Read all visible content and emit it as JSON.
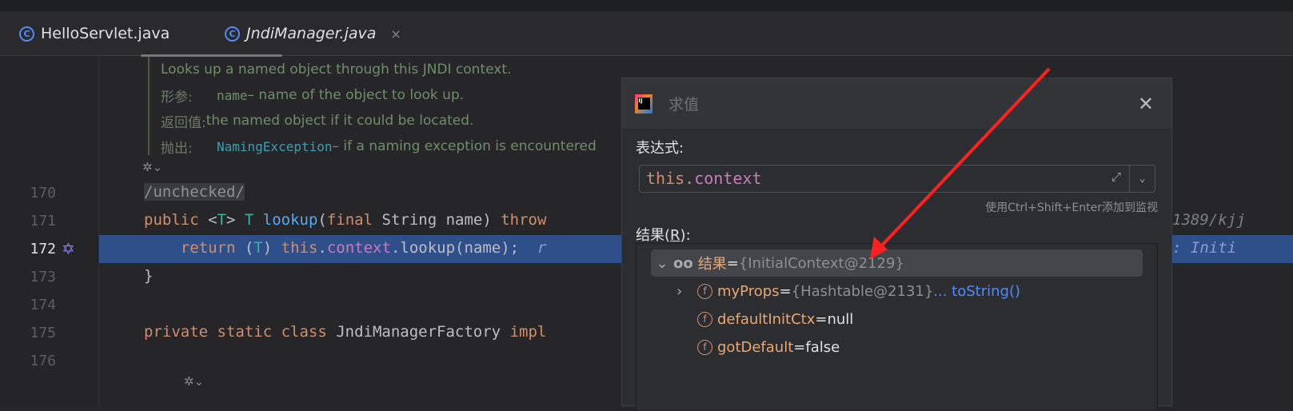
{
  "tabs": [
    {
      "label": "HelloServlet.java",
      "icon": "class-icon"
    },
    {
      "label": "JndiManager.java",
      "icon": "class-icon",
      "active": true,
      "close": "×"
    }
  ],
  "doc": {
    "summary": "Looks up a named object through this JNDI context.",
    "params_label": "形参:",
    "param_name": "name",
    "param_desc": " – name of the object to look up.",
    "returns_label": "返回值:",
    "returns_desc": "the named object if it could be located.",
    "throws_label": "抛出:",
    "throws_name": "NamingException",
    "throws_desc": " – if a naming exception is encountered"
  },
  "lines": [
    {
      "n": "170",
      "annotation": "/unchecked/"
    },
    {
      "n": "171",
      "kw1": "public ",
      "lt": "<",
      "t1": "T",
      "gt": "> ",
      "t2": "T ",
      "fn": "lookup",
      "rest": "(",
      "kw2": "final ",
      "rest2": "String name) ",
      "kw3": "throw",
      "tail": "1389/kjj"
    },
    {
      "n": "172",
      "kw": "return ",
      "p1": "(",
      "t": "T",
      "p2": ") ",
      "this": "this",
      "dot": ".",
      "ctx": "context",
      "rest": ".lookup(name);  ",
      "hint": "r",
      "tail": ": Initi"
    },
    {
      "n": "173",
      "text": "}"
    },
    {
      "n": "174"
    },
    {
      "n": "175",
      "kw": "private static class ",
      "rest": "JndiManagerFactory ",
      "kw2": "impl"
    },
    {
      "n": "176"
    }
  ],
  "dialog": {
    "title": "求值",
    "close": "✕",
    "expression_label": "表达式:",
    "expression_this": "this.",
    "expression_ctx": "context",
    "hint": "使用Ctrl+Shift+Enter添加到监视",
    "result_label_pre": "结果(",
    "result_label_key": "R",
    "result_label_post": "):",
    "tree": [
      {
        "toggle": "⌄",
        "icon": "watch-icon",
        "glyph": "oo",
        "name": "结果",
        "eq": " = ",
        "value": "{InitialContext@2129}"
      },
      {
        "toggle": "›",
        "icon": "field-icon",
        "name": "myProps",
        "eq": " = ",
        "value": "{Hashtable@2131}",
        "link": " ... toString()"
      },
      {
        "icon": "field-icon",
        "name": "defaultInitCtx",
        "eq": " = ",
        "value": "null"
      },
      {
        "icon": "field-icon",
        "name": "gotDefault",
        "eq": " = ",
        "value": "false"
      }
    ]
  },
  "colors": {
    "accent": "#548af7",
    "keyword": "#cf8e6d",
    "highlight": "#2f4f8a",
    "arrow": "#ff2020"
  }
}
